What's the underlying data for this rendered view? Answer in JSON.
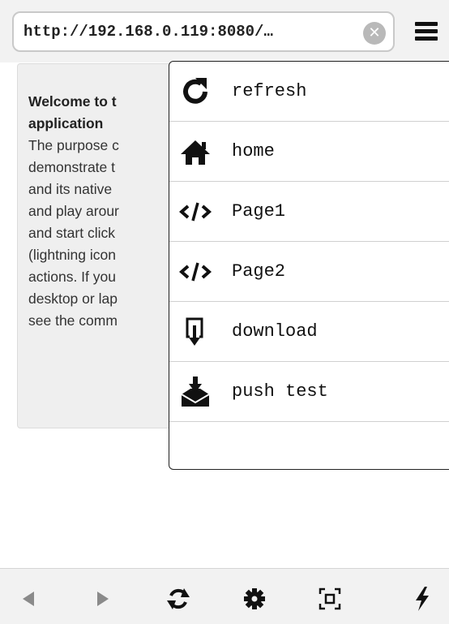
{
  "address_bar": {
    "url": "http://192.168.0.119:8080/…",
    "clear_glyph": "✕"
  },
  "content": {
    "welcome_line1": "Welcome to t",
    "welcome_line2": "application",
    "lines": [
      "The purpose c",
      "demonstrate t",
      "and its native",
      "and play arour",
      "and start click",
      "(lightning icon",
      "actions. If you",
      "desktop or lap",
      "see the comm"
    ]
  },
  "menu": {
    "items": [
      {
        "label": "refresh",
        "icon": "refresh-icon"
      },
      {
        "label": "home",
        "icon": "home-icon"
      },
      {
        "label": "Page1",
        "icon": "code-icon"
      },
      {
        "label": "Page2",
        "icon": "code-icon"
      },
      {
        "label": "download",
        "icon": "download-icon"
      },
      {
        "label": "push test",
        "icon": "push-notification-icon"
      }
    ]
  },
  "bottom_toolbar": {
    "icons": [
      "back-icon",
      "forward-icon",
      "reload-icon",
      "settings-icon",
      "fullscreen-icon",
      "lightning-icon"
    ]
  }
}
